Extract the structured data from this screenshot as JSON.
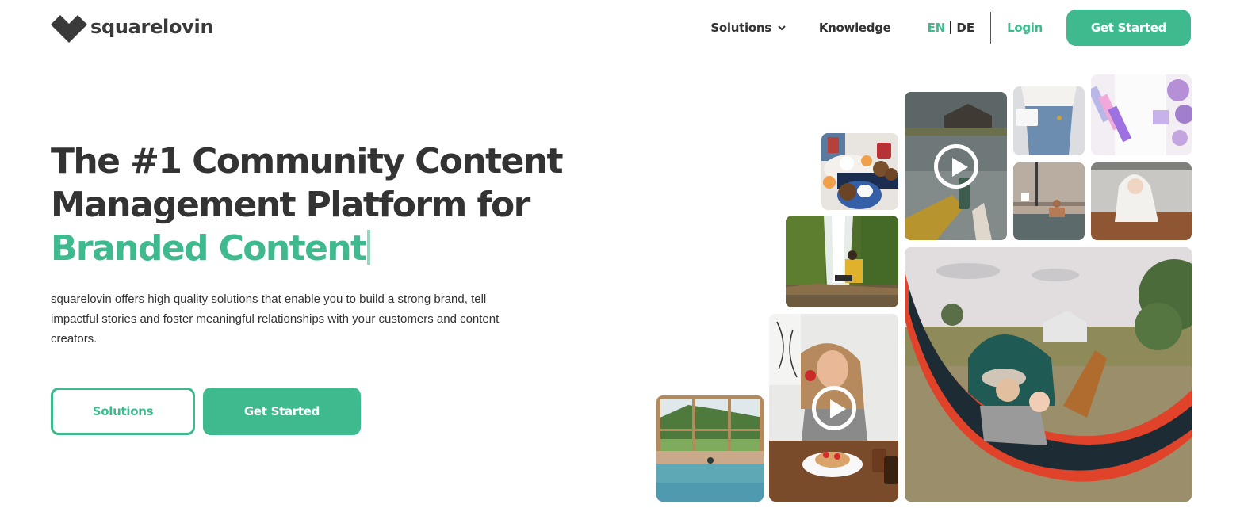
{
  "brand": {
    "name": "squarelovin",
    "accent_color": "#3fb98e",
    "text_color": "#333333"
  },
  "nav": {
    "items": [
      {
        "label": "Solutions",
        "has_dropdown": true
      },
      {
        "label": "Knowledge",
        "has_dropdown": false
      }
    ],
    "languages": {
      "active": "EN",
      "other": "DE"
    },
    "login_label": "Login",
    "cta_label": "Get Started"
  },
  "hero": {
    "title_line1": "The #1 Community Content",
    "title_line2": "Management Platform for",
    "title_accent": "Branded Content",
    "description": "squarelovin offers high quality solutions that enable you to build a strong brand, tell impactful stories and foster meaningful relationships with your customers and content creators.",
    "buttons": {
      "secondary_label": "Solutions",
      "primary_label": "Get Started"
    }
  },
  "gallery": {
    "photos": [
      {
        "id": "pool",
        "subject": "woman in indoor pool with mountain view",
        "video": false
      },
      {
        "id": "food",
        "subject": "breakfast table with coffee and muffins",
        "video": false
      },
      {
        "id": "waterfall",
        "subject": "woman in yellow jacket at waterfall",
        "video": false
      },
      {
        "id": "pancakes",
        "subject": "woman with strawberry pancakes",
        "video": true
      },
      {
        "id": "lake",
        "subject": "lake house with drink can",
        "video": true
      },
      {
        "id": "jeans",
        "subject": "person with white purse and jeans",
        "video": false
      },
      {
        "id": "notebook",
        "subject": "highlighters and journal with lilacs",
        "video": false
      },
      {
        "id": "spa",
        "subject": "man in rooftop spa pool",
        "video": false
      },
      {
        "id": "baby",
        "subject": "baby in hooded towel",
        "video": false
      },
      {
        "id": "hammock",
        "subject": "mother and child in hammock at campsite",
        "video": false
      }
    ]
  }
}
